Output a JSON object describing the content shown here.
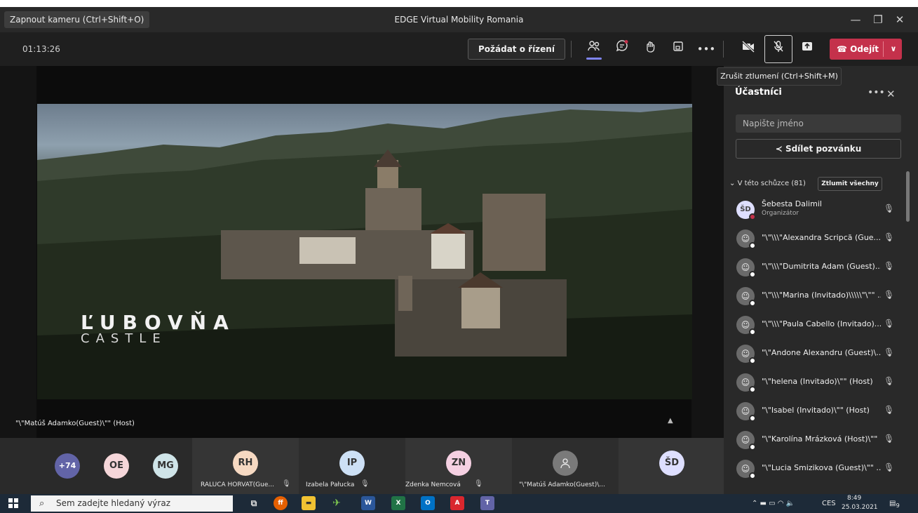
{
  "window": {
    "title": "EDGE Virtual Mobility Romania",
    "camera_chip": "Zapnout kameru (Ctrl+Shift+O)"
  },
  "toolbar": {
    "timer": "01:13:26",
    "request_control": "Požádat o řízení",
    "leave_label": "Odejít",
    "tooltip": "Zrušit ztlumení (Ctrl+Shift+M)"
  },
  "stage": {
    "speaker_caption": "\"\\\"Matúš Adamko(Guest)\\\"\" (Host)",
    "video_title": "ĽUBOVŇA",
    "video_subtitle": "CASTLE"
  },
  "gallery": {
    "overflow_count": "+74",
    "avatars": [
      {
        "initials": "OE",
        "color": "#f5d6d9"
      },
      {
        "initials": "MG",
        "color": "#cfe4e8"
      }
    ],
    "tiles": [
      {
        "initials": "RH",
        "name": "RALUCA HORVAT(Gue...",
        "color": "#f6d9c2"
      },
      {
        "initials": "IP",
        "name": "Izabela Pałucka",
        "color": "#cde0f5"
      },
      {
        "initials": "ZN",
        "name": "Zdenka Nemcová",
        "color": "#f5d0e2"
      },
      {
        "initials": "",
        "name": "\"\\\"Matúš Adamko(Guest)\\...",
        "color": "#7a7a7a"
      },
      {
        "initials": "ŠD",
        "name": "",
        "color": "#dedfff"
      }
    ]
  },
  "panel": {
    "title": "Účastníci",
    "search_placeholder": "Napište jméno",
    "share_invite": "Sdílet pozvánku",
    "section_label": "V této schůzce (81)",
    "mute_all": "Ztlumit všechny",
    "participants": [
      {
        "name": "Šebesta Dalimil",
        "role": "Organizátor",
        "initials": "ŠD"
      },
      {
        "name": "\"\\\"\\\\\\\"Alexandra Scripcă (Gue...",
        "role": "",
        "initials": ""
      },
      {
        "name": "\"\\\"\\\\\\\"Dumitrita Adam (Guest)...",
        "role": "",
        "initials": ""
      },
      {
        "name": "\"\\\"\\\\\\\"Marina (Invitado)\\\\\\\\\\\"\\\"\" ...",
        "role": "",
        "initials": ""
      },
      {
        "name": "\"\\\"\\\\\\\"Paula Cabello (Invitado)...",
        "role": "",
        "initials": ""
      },
      {
        "name": "\"\\\"Andone Alexandru (Guest)\\...",
        "role": "",
        "initials": ""
      },
      {
        "name": "\"\\\"helena (Invitado)\\\"\" (Host)",
        "role": "",
        "initials": ""
      },
      {
        "name": "\"\\\"Isabel (Invitado)\\\"\" (Host)",
        "role": "",
        "initials": ""
      },
      {
        "name": "\"\\\"Karolína Mrázková (Host)\\\"\"",
        "role": "",
        "initials": ""
      },
      {
        "name": "\"\\\"Lucia Smizikova (Guest)\\\"\" ...",
        "role": "",
        "initials": ""
      }
    ]
  },
  "taskbar": {
    "search_placeholder": "Sem zadejte hledaný výraz",
    "language": "CES",
    "time": "8:49",
    "date": "25.03.2021",
    "notification_count": "9"
  }
}
